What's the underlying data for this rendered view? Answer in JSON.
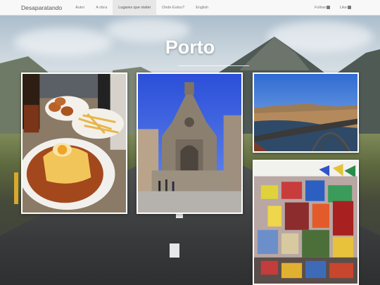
{
  "navbar": {
    "brand": "Desaparatando",
    "items": [
      {
        "label": "Autor",
        "active": false
      },
      {
        "label": "A obra",
        "active": false
      },
      {
        "label": "Lugares que visitei",
        "active": true
      },
      {
        "label": "Onde Estou?",
        "active": false
      },
      {
        "label": "English",
        "active": false
      }
    ],
    "follow_label": "Follow",
    "like_label": "Like",
    "follow_icon": "instagram-icon",
    "like_icon": "facebook-icon"
  },
  "page": {
    "title": "Porto"
  },
  "gallery": [
    {
      "subject": "francesinha-food-photo"
    },
    {
      "subject": "clerigos-church-photo"
    },
    {
      "subject": "douro-river-bridge-photo"
    },
    {
      "subject": "souvenir-shop-photo"
    }
  ],
  "colors": {
    "navbar_bg": "#f8f8f8",
    "active_item_bg": "#e7e7e7",
    "title_color": "#ffffff"
  }
}
